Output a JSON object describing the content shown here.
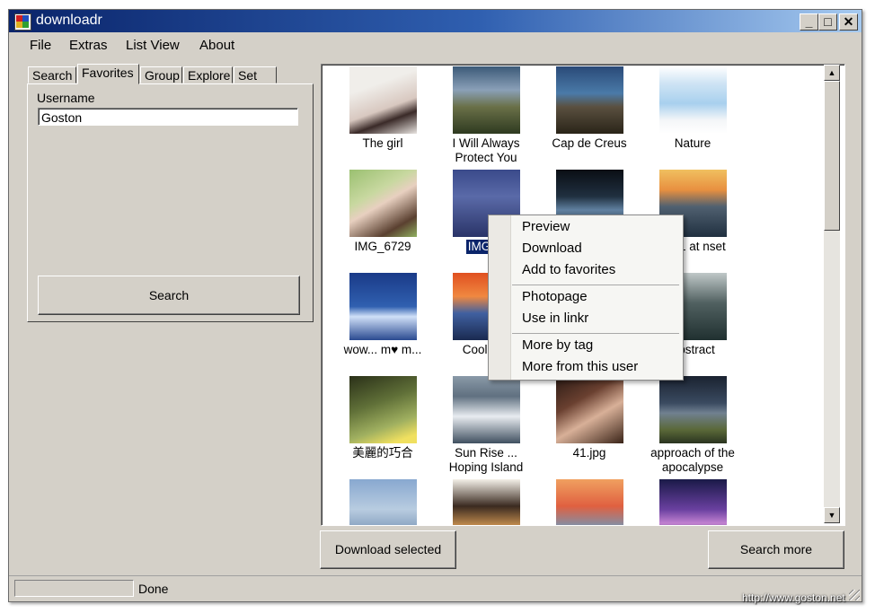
{
  "window": {
    "title": "downloadr"
  },
  "title_buttons": [
    "minimize-icon",
    "maximize-icon",
    "close-icon"
  ],
  "menu": [
    "File",
    "Extras",
    "List View",
    "About"
  ],
  "tabs": [
    "Search",
    "Favorites",
    "Group",
    "Explore",
    "Set"
  ],
  "active_tab": "Favorites",
  "favorites": {
    "username_label": "Username",
    "username_value": "Goston",
    "search_button": "Search"
  },
  "photos": [
    {
      "caption": "The girl"
    },
    {
      "caption": "I Will Always Protect You"
    },
    {
      "caption": "Cap de Creus"
    },
    {
      "caption": "Nature"
    },
    {
      "caption": "IMG_6729"
    },
    {
      "caption": "IMG_6"
    },
    {
      "caption": ""
    },
    {
      "caption": "i 101 at nset"
    },
    {
      "caption": "wow... m♥ m..."
    },
    {
      "caption": "Cool Sur"
    },
    {
      "caption": ""
    },
    {
      "caption": "Abstract"
    },
    {
      "caption": "美麗的巧合"
    },
    {
      "caption": "Sun Rise ... Hoping Island"
    },
    {
      "caption": "41.jpg"
    },
    {
      "caption": "approach of the apocalypse"
    },
    {
      "caption": ""
    },
    {
      "caption": ""
    },
    {
      "caption": ""
    },
    {
      "caption": ""
    }
  ],
  "context_menu": [
    "Preview",
    "Download",
    "Add to favorites",
    "Photopage",
    "Use in linkr",
    "More by tag",
    "More from this user"
  ],
  "buttons": {
    "download_selected": "Download selected",
    "search_more": "Search more"
  },
  "status": {
    "text": "Done",
    "progress": 0
  },
  "watermark": "http://www.goston.net",
  "colors": {
    "title_active": "#0a246a",
    "face": "#d4d0c8",
    "selection": "#0a246a"
  }
}
